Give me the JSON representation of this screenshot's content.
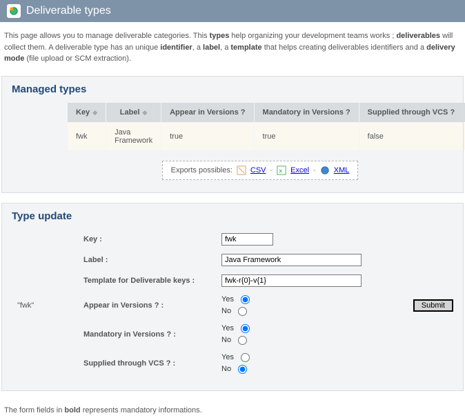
{
  "pageTitle": "Deliverable types",
  "intro": {
    "p1a": "This page allows you to manage deliverable categories. This ",
    "b1": "types",
    "p1b": " help organizing your development teams works ; ",
    "b2": "deliverables",
    "p1c": " will collect them. A deliverable type has an unique ",
    "b3": "identifier",
    "p1d": ", a ",
    "b4": "label",
    "p1e": ", a ",
    "b5": "template",
    "p1f": " that helps creating deliverables identifiers and a ",
    "b6": "delivery mode",
    "p1g": " (file upload or SCM extraction)."
  },
  "managed": {
    "heading": "Managed types",
    "cols": {
      "key": "Key",
      "label": "Label",
      "appear": "Appear in Versions ?",
      "mandatory": "Mandatory in Versions ?",
      "vcs": "Supplied through VCS ?"
    },
    "row": {
      "key": "fwk",
      "label": "Java Framework",
      "appear": "true",
      "mandatory": "true",
      "vcs": "false"
    }
  },
  "exports": {
    "prefix": "Exports possibles:",
    "csv": "CSV",
    "excel": "Excel",
    "xml": "XML"
  },
  "update": {
    "heading": "Type update",
    "side": "\"fwk\"",
    "labels": {
      "key": "Key :",
      "label": "Label :",
      "template": "Template for Deliverable keys :",
      "appear": "Appear in Versions ? :",
      "mandatory": "Mandatory in Versions ? :",
      "vcs": "Supplied through VCS ? :"
    },
    "values": {
      "key": "fwk",
      "label": "Java Framework",
      "template": "fwk-r{0}-v{1}"
    },
    "yes": "Yes",
    "no": "No",
    "submit": "Submit"
  },
  "footnote": {
    "a": "The form fields in ",
    "b": "bold",
    "c": " represents mandatory informations."
  }
}
